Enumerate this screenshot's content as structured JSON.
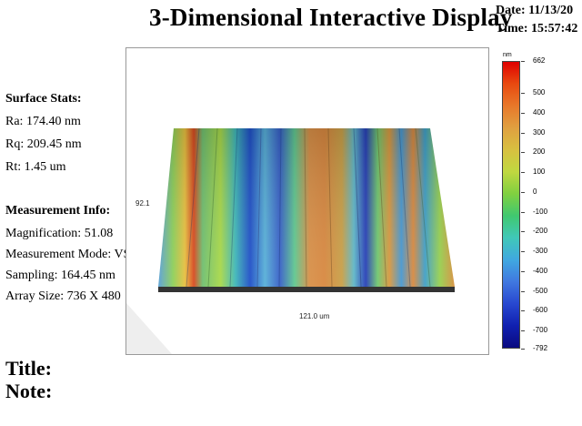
{
  "header": {
    "title": "3-Dimensional Interactive Display",
    "date": "Date: 11/13/20",
    "time": "Time: 15:57:42"
  },
  "surface_stats": {
    "heading": "Surface Stats:",
    "ra": "Ra: 174.40 nm",
    "rq": "Rq: 209.45 nm",
    "rt": "Rt: 1.45 um"
  },
  "measurement_info": {
    "heading": "Measurement Info:",
    "magnification": "Magnification: 51.08",
    "mode": "Measurement Mode: VSI",
    "sampling": "Sampling: 164.45 nm",
    "array_size": "Array Size: 736 X 480"
  },
  "plot": {
    "y_axis_label": "92.1",
    "x_axis_label": "121.0 um"
  },
  "colorbar": {
    "unit": "nm",
    "ticks": [
      "662",
      "500",
      "400",
      "300",
      "200",
      "100",
      "0",
      "-100",
      "-200",
      "-300",
      "-400",
      "-500",
      "-600",
      "-700",
      "-792"
    ],
    "tick_values": [
      662,
      500,
      400,
      300,
      200,
      100,
      0,
      -100,
      -200,
      -300,
      -400,
      -500,
      -600,
      -700,
      -792
    ],
    "max": 662,
    "min": -792,
    "gradient": [
      "#e00000",
      "#e84a10",
      "#e8782a",
      "#e0a040",
      "#d8c040",
      "#c0d840",
      "#80d040",
      "#40c870",
      "#40c8b8",
      "#40a8e0",
      "#4078e0",
      "#2848d0",
      "#1020b0",
      "#0a0a80"
    ]
  },
  "footer": {
    "title_label": "Title:",
    "note_label": "Note:"
  }
}
